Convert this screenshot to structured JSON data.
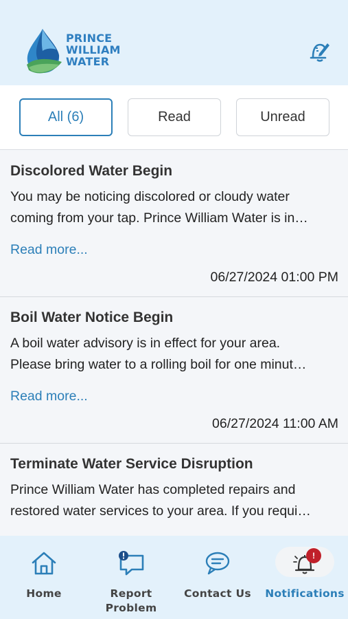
{
  "header": {
    "logo_lines": [
      "PRINCE",
      "WILLIAM",
      "WATER"
    ]
  },
  "filters": [
    {
      "label": "All (6)",
      "active": true
    },
    {
      "label": "Read",
      "active": false
    },
    {
      "label": "Unread",
      "active": false
    }
  ],
  "notifications": [
    {
      "title": "Discolored Water Begin",
      "body_lines": [
        "You may be noticing discolored or cloudy water",
        "coming from your tap. Prince William Water is in…"
      ],
      "read_more": "Read more...",
      "date": "06/27/2024 01:00 PM"
    },
    {
      "title": "Boil Water Notice Begin",
      "body_lines": [
        "A boil water advisory is in effect for your area.",
        "Please bring water to a rolling boil for one minut…"
      ],
      "read_more": "Read more...",
      "date": "06/27/2024 11:00 AM"
    },
    {
      "title": "Terminate Water Service Disruption",
      "body_lines": [
        "Prince William Water has completed repairs and",
        "restored water services to your area. If you requi…"
      ],
      "read_more": "",
      "date": ""
    }
  ],
  "tabbar": {
    "home": "Home",
    "report_line1": "Report",
    "report_line2": "Problem",
    "contact": "Contact Us",
    "notifications": "Notifications",
    "badge": "!"
  },
  "colors": {
    "accent": "#2c7fb8",
    "header_bg": "#e3f1fb",
    "badge_red": "#c0202a"
  },
  "icons": {
    "header_action": "pen-alarm-icon",
    "home": "home-icon",
    "report": "chat-alert-icon",
    "contact": "chat-bubbles-icon",
    "notifications": "bell-icon"
  }
}
